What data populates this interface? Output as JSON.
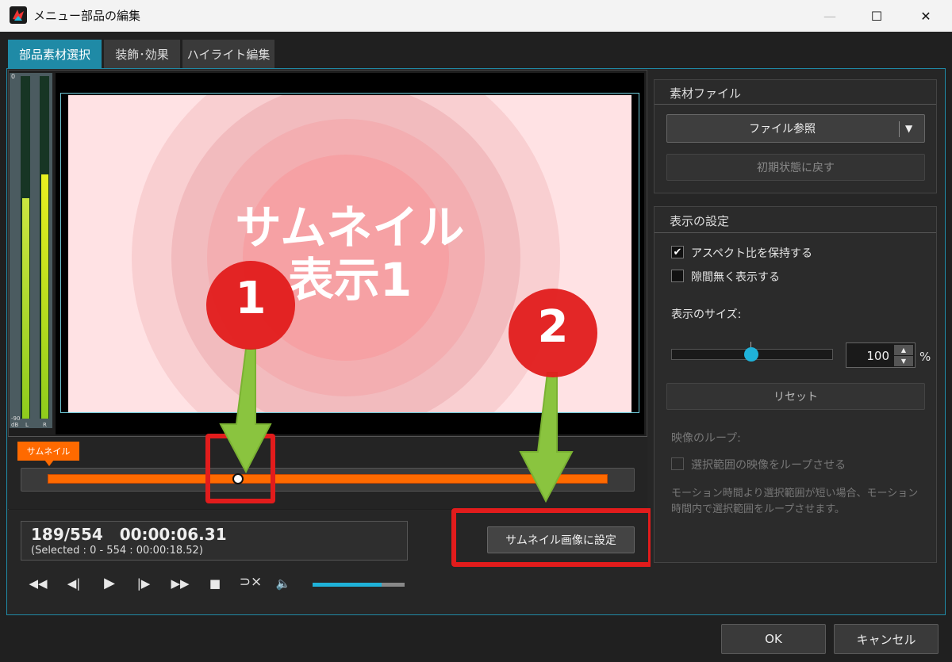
{
  "window": {
    "title": "メニュー部品の編集",
    "controls": {
      "minimize": "—",
      "maximize": "☐",
      "close": "✕"
    }
  },
  "tabs": [
    {
      "label": "部品素材選択",
      "active": true
    },
    {
      "label": "装飾･効果",
      "active": false
    },
    {
      "label": "ハイライト編集",
      "active": false
    }
  ],
  "meter": {
    "top_label": "0",
    "bottom_labels": {
      "db_value": "-90",
      "db": "dB",
      "left": "L",
      "right": "R"
    },
    "left_level": 0.75,
    "right_level": 0.7
  },
  "preview": {
    "text_line1": "サムネイル",
    "text_line2": "表示1"
  },
  "annotations": [
    {
      "number": "1"
    },
    {
      "number": "2"
    }
  ],
  "timeline": {
    "marker_label": "サムネイル",
    "position": 0.34
  },
  "status": {
    "frame_time": "189/554   00:00:06.31",
    "selection": "(Selected : 0 - 554 : 00:00:18.52)"
  },
  "set_thumbnail_button": "サムネイル画像に設定",
  "transport": {
    "rewind": "◀◀",
    "step_back": "◀|",
    "play": "▶",
    "step_forward": "|▶",
    "fast_forward": "▶▶",
    "stop": "■",
    "loop_off": "⊃×",
    "volume": "🔈",
    "volume_level": 0.75
  },
  "material_file": {
    "heading": "素材ファイル",
    "browse_button": "ファイル参照",
    "dropdown_arrow": "▼",
    "reset_initial_button": "初期状態に戻す"
  },
  "display_settings": {
    "heading": "表示の設定",
    "keep_aspect_label": "アスペクト比を保持する",
    "keep_aspect_checked": true,
    "fill_label": "隙間無く表示する",
    "fill_checked": false,
    "size_label": "表示のサイズ:",
    "size_value": "100",
    "size_unit": "%",
    "size_slider_level": 0.49,
    "reset_button": "リセット",
    "loop_heading": "映像のループ:",
    "loop_label": "選択範囲の映像をループさせる",
    "loop_note": "モーション時間より選択範囲が短い場合、モーション時間内で選択範囲をループさせます。"
  },
  "footer": {
    "ok": "OK",
    "cancel": "キャンセル"
  },
  "colors": {
    "accent_cyan": "#1fb2d9",
    "tab_active": "#1f8aa6",
    "timeline_orange": "#ff6a00",
    "highlight_red": "#e21c1c",
    "arrow_green": "#8ac43f"
  }
}
